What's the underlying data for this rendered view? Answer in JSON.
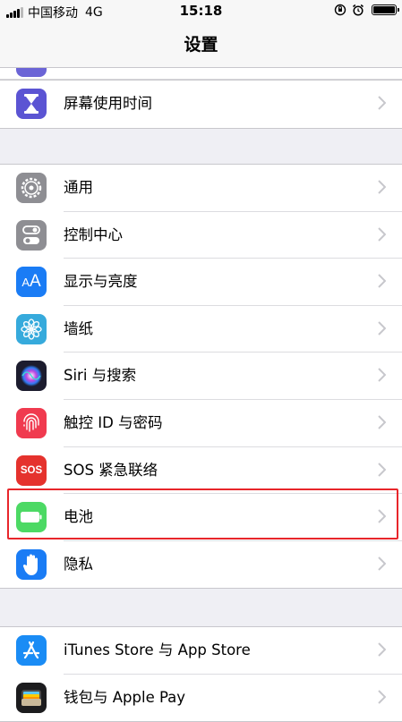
{
  "status_bar": {
    "carrier": "中国移动",
    "network": "4G",
    "time": "15:18"
  },
  "nav": {
    "title": "设置"
  },
  "groups": [
    {
      "rows": [
        {
          "label": "屏幕使用时间",
          "icon": "hourglass-icon",
          "color": "#5b54d3"
        }
      ]
    },
    {
      "rows": [
        {
          "label": "通用",
          "icon": "gear-icon",
          "color": "#8e8e93"
        },
        {
          "label": "控制中心",
          "icon": "toggles-icon",
          "color": "#8e8e93"
        },
        {
          "label": "显示与亮度",
          "icon": "aa-icon",
          "icon_text": "AA",
          "color": "#1a7cf5"
        },
        {
          "label": "墙纸",
          "icon": "flower-icon",
          "color": "#36aadc"
        },
        {
          "label": "Siri 与搜索",
          "icon": "siri-icon",
          "color": "#1c1c2e"
        },
        {
          "label": "触控 ID 与密码",
          "icon": "fingerprint-icon",
          "color": "#f03a4f"
        },
        {
          "label": "SOS 紧急联络",
          "icon": "sos-icon",
          "icon_text": "SOS",
          "color": "#e5322d"
        },
        {
          "label": "电池",
          "icon": "battery-icon",
          "color": "#4cd964"
        },
        {
          "label": "隐私",
          "icon": "hand-icon",
          "color": "#1a7cf5"
        }
      ]
    },
    {
      "rows": [
        {
          "label": "iTunes Store 与 App Store",
          "icon": "app-store-icon",
          "color": "#1a8cf5"
        },
        {
          "label": "钱包与 Apple Pay",
          "icon": "wallet-icon",
          "color": "#1c1c1e"
        }
      ]
    }
  ]
}
